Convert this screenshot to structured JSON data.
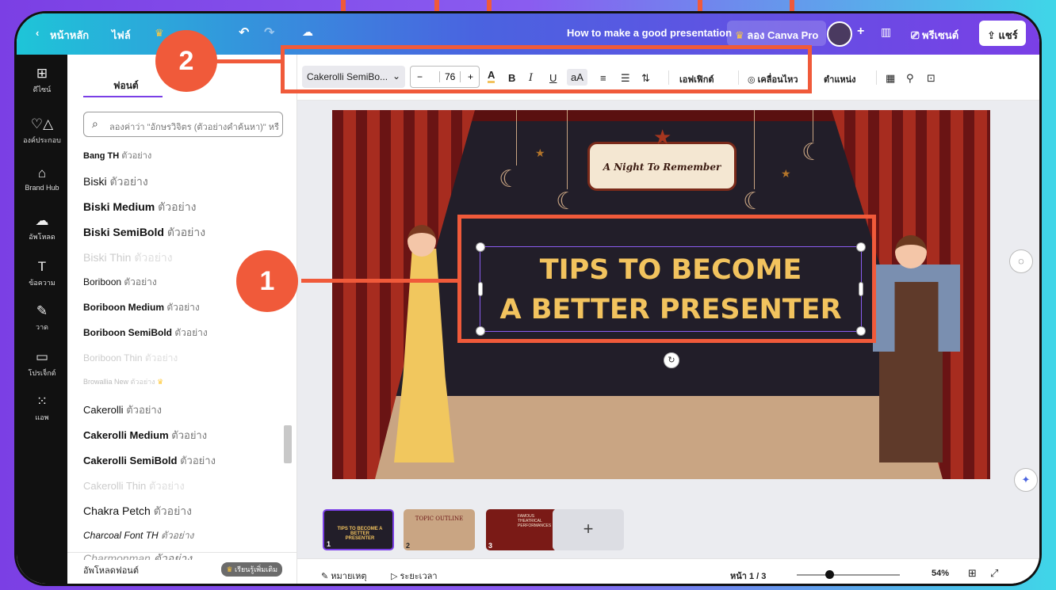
{
  "topbar": {
    "home": "หน้าหลัก",
    "file": "ไฟล์",
    "doc_title": "How to make a good presentation",
    "try_pro": "ลอง Canva Pro",
    "present": "พรีเซนต์",
    "share": "แชร์"
  },
  "rail": {
    "items": [
      "ดีไซน์",
      "องค์ประกอบ",
      "Brand Hub",
      "อัพโหลด",
      "ข้อความ",
      "วาด",
      "โปรเจ็กต์",
      "แอพ"
    ]
  },
  "panel": {
    "tab_label": "ฟอนต์",
    "search_placeholder": "ลองค่าว่า \"อักษรวิจิตร (ตัวอย่างคำค้นหา)\" หรื",
    "example_word": "ตัวอย่าง",
    "fonts": [
      "Bang TH",
      "Biski",
      "Biski Medium",
      "Biski SemiBold",
      "Biski Thin",
      "Boriboon",
      "Boriboon Medium",
      "Boriboon SemiBold",
      "Boriboon Thin",
      "Browallia New",
      "Cakerolli",
      "Cakerolli Medium",
      "Cakerolli SemiBold",
      "Cakerolli Thin",
      "Chakra Petch",
      "Charcoal Font TH",
      "Charmonman"
    ],
    "footer_upload": "อัพโหลดฟอนต์",
    "footer_learn_more": "เรียนรู้เพิ่มเติม"
  },
  "toolbar": {
    "font_name": "Cakerolli SemiBo...",
    "font_size": "76",
    "minus": "−",
    "plus": "+",
    "effects": "เอฟเฟิกต์",
    "animate": "เคลื่อนไหว",
    "position": "ตำแหน่ง"
  },
  "slide": {
    "sign_text": "A Night To Remember",
    "title_line1": "TIPS TO BECOME",
    "title_line2": "A BETTER PRESENTER"
  },
  "pages": {
    "thumbs": [
      {
        "num": "1",
        "caption": "TIPS TO BECOME A BETTER PRESENTER"
      },
      {
        "num": "2",
        "caption": "TOPIC OUTLINE"
      },
      {
        "num": "3",
        "caption": "FAMOUS THEATRICAL PERFORMANCES"
      }
    ],
    "add": "+"
  },
  "bottombar": {
    "notes": "หมายเหตุ",
    "timer": "ระยะเวลา",
    "page_indicator": "หน้า 1 / 3",
    "zoom": "54%"
  },
  "callouts": {
    "one": "1",
    "two": "2"
  },
  "colors": {
    "accent": "#7a3fe6",
    "callout": "#f05a3a",
    "title_text": "#f2c35e"
  }
}
